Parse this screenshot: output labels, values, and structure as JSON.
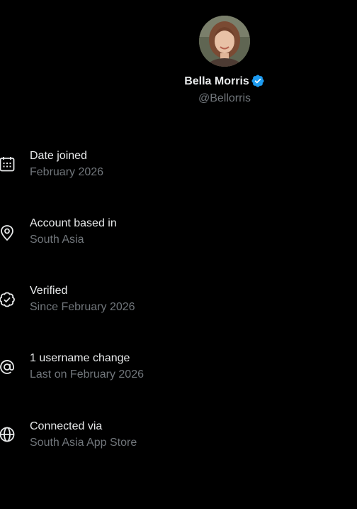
{
  "profile": {
    "display_name": "Bella Morris",
    "handle": "@Bellorris",
    "verified_color": "#1d9bf0"
  },
  "info_items": [
    {
      "icon": "calendar-icon",
      "title": "Date joined",
      "subtitle": "February 2026"
    },
    {
      "icon": "location-pin-icon",
      "title": "Account based in",
      "subtitle": "South Asia"
    },
    {
      "icon": "verified-badge-icon",
      "title": "Verified",
      "subtitle": "Since February 2026"
    },
    {
      "icon": "at-sign-icon",
      "title": "1 username change",
      "subtitle": "Last on February 2026"
    },
    {
      "icon": "globe-icon",
      "title": "Connected via",
      "subtitle": "South Asia App Store"
    }
  ],
  "colors": {
    "background": "#000000",
    "primary_text": "#e7e9ea",
    "secondary_text": "#71767b"
  }
}
